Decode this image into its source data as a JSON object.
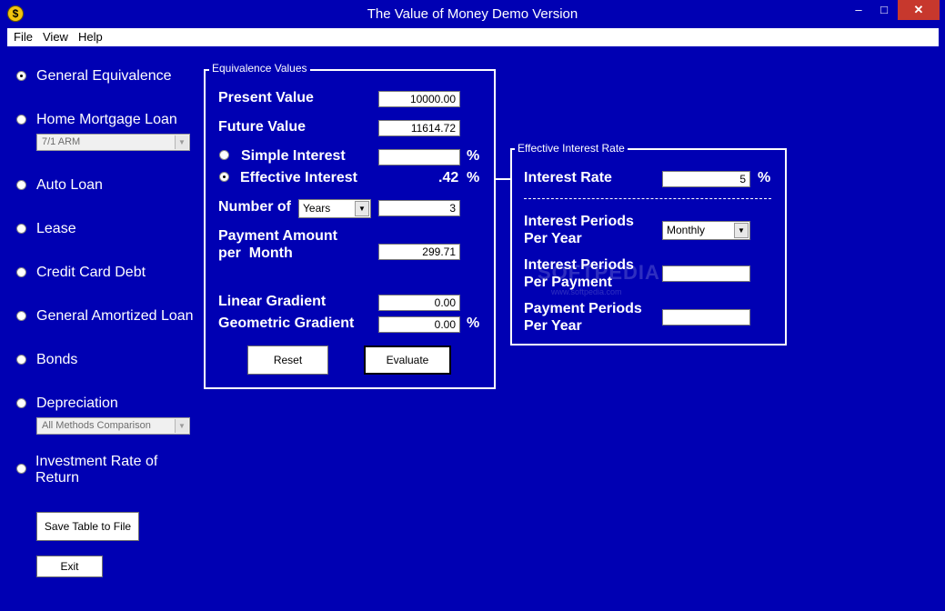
{
  "window": {
    "title": "The Value of Money Demo Version",
    "app_icon_glyph": "$",
    "controls": {
      "minimize": "–",
      "maximize": "□",
      "close": "✕"
    }
  },
  "menu": {
    "file": "File",
    "view": "View",
    "help": "Help"
  },
  "sidebar": {
    "options": [
      {
        "label": "General Equivalence",
        "selected": true
      },
      {
        "label": "Home Mortgage Loan",
        "selected": false
      },
      {
        "label": "Auto Loan",
        "selected": false
      },
      {
        "label": "Lease",
        "selected": false
      },
      {
        "label": "Credit Card Debt",
        "selected": false
      },
      {
        "label": "General Amortized Loan",
        "selected": false
      },
      {
        "label": "Bonds",
        "selected": false
      },
      {
        "label": "Depreciation",
        "selected": false
      },
      {
        "label": "Investment Rate of Return",
        "selected": false
      }
    ],
    "mortgage_type": "7/1 ARM",
    "depreciation_method": "All Methods Comparison",
    "save_button": "Save Table to File",
    "exit_button": "Exit"
  },
  "equivalence": {
    "legend": "Equivalence Values",
    "present_value_label": "Present Value",
    "present_value": "10000.00",
    "future_value_label": "Future Value",
    "future_value": "11614.72",
    "simple_interest_label": "Simple Interest",
    "simple_interest_value": "",
    "effective_interest_label": "Effective Interest",
    "effective_interest_value": ".42",
    "interest_mode_selected": "Effective Interest",
    "percent_sign": "%",
    "number_of_label": "Number of",
    "number_of_unit": "Years",
    "number_of_value": "3",
    "payment_label_line1": "Payment Amount",
    "payment_label_line2": "per  Month",
    "payment_value": "299.71",
    "linear_gradient_label": "Linear Gradient",
    "linear_gradient_value": "0.00",
    "geometric_gradient_label": "Geometric Gradient",
    "geometric_gradient_value": "0.00",
    "reset_button": "Reset",
    "evaluate_button": "Evaluate"
  },
  "effective_rate": {
    "legend": "Effective Interest Rate",
    "interest_rate_label": "Interest Rate",
    "interest_rate_value": "5",
    "percent_sign": "%",
    "interest_periods_per_year_line1": "Interest Periods",
    "interest_periods_per_year_line2": "Per Year",
    "interest_periods_per_year_value": "Monthly",
    "interest_periods_per_payment_line1": "Interest Periods",
    "interest_periods_per_payment_line2": "Per Payment",
    "interest_periods_per_payment_value": "",
    "payment_periods_per_year_line1": "Payment Periods",
    "payment_periods_per_year_line2": "Per Year",
    "payment_periods_per_year_value": ""
  },
  "watermark": {
    "logo": "SOFTPEDIA",
    "url": "www.softpedia.com"
  },
  "colors": {
    "background": "#0000b3",
    "foreground": "#ffffff",
    "close_button": "#c7382d"
  }
}
